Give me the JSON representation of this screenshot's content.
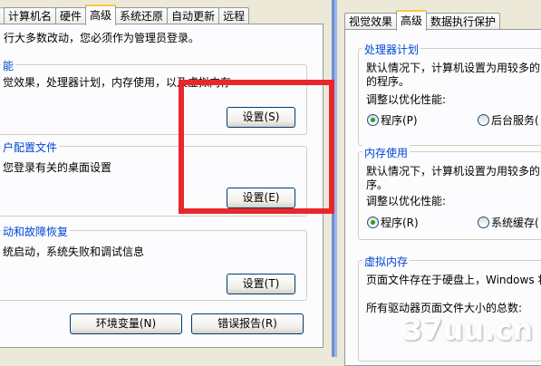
{
  "left_window": {
    "tabs": [
      "计算机名",
      "硬件",
      "高级",
      "系统还原",
      "自动更新",
      "远程"
    ],
    "active_tab": "高级",
    "intro": "行大多数改动，您必须作为管理员登录。",
    "performance": {
      "title": "能",
      "desc": "觉效果，处理器计划，内存使用，以及虚拟内存",
      "button": "设置(S)"
    },
    "user_profiles": {
      "title": "户配置文件",
      "desc": "您登录有关的桌面设置",
      "button": "设置(E)"
    },
    "startup_recovery": {
      "title": "动和故障恢复",
      "desc": "统启动，系统失败和调试信息",
      "button": "设置(T)"
    },
    "env_button": "环境变量(N)",
    "error_report_button": "错误报告(R)"
  },
  "right_window": {
    "tabs": [
      "视觉效果",
      "高级",
      "数据执行保护"
    ],
    "active_tab": "高级",
    "processor": {
      "title": "处理器计划",
      "desc_line1": "默认情况下，计算机设置为用较多的",
      "desc_line2": "的程序。",
      "adjust": "调整以优化性能:",
      "option1": "程序(P)",
      "option2": "后台服务(",
      "selected": "程序(P)"
    },
    "memory": {
      "title": "内存使用",
      "desc_line1": "默认情况下，计算机设置为用较多的",
      "desc_line2": "序。",
      "adjust": "调整以优化性能:",
      "option1": "程序(R)",
      "option2": "系统缓存(",
      "selected": "程序(R)"
    },
    "virtual_memory": {
      "title": "虚拟内存",
      "desc_line1": "页面文件存在于硬盘上，Windows 将",
      "desc_line2": "所有驱动器页面文件大小的总数:"
    }
  },
  "watermark": "37uu.cn",
  "colors": {
    "highlight": "#e8272d",
    "group_title": "#0046d5",
    "active_tab_accent": "#ffc83c"
  }
}
